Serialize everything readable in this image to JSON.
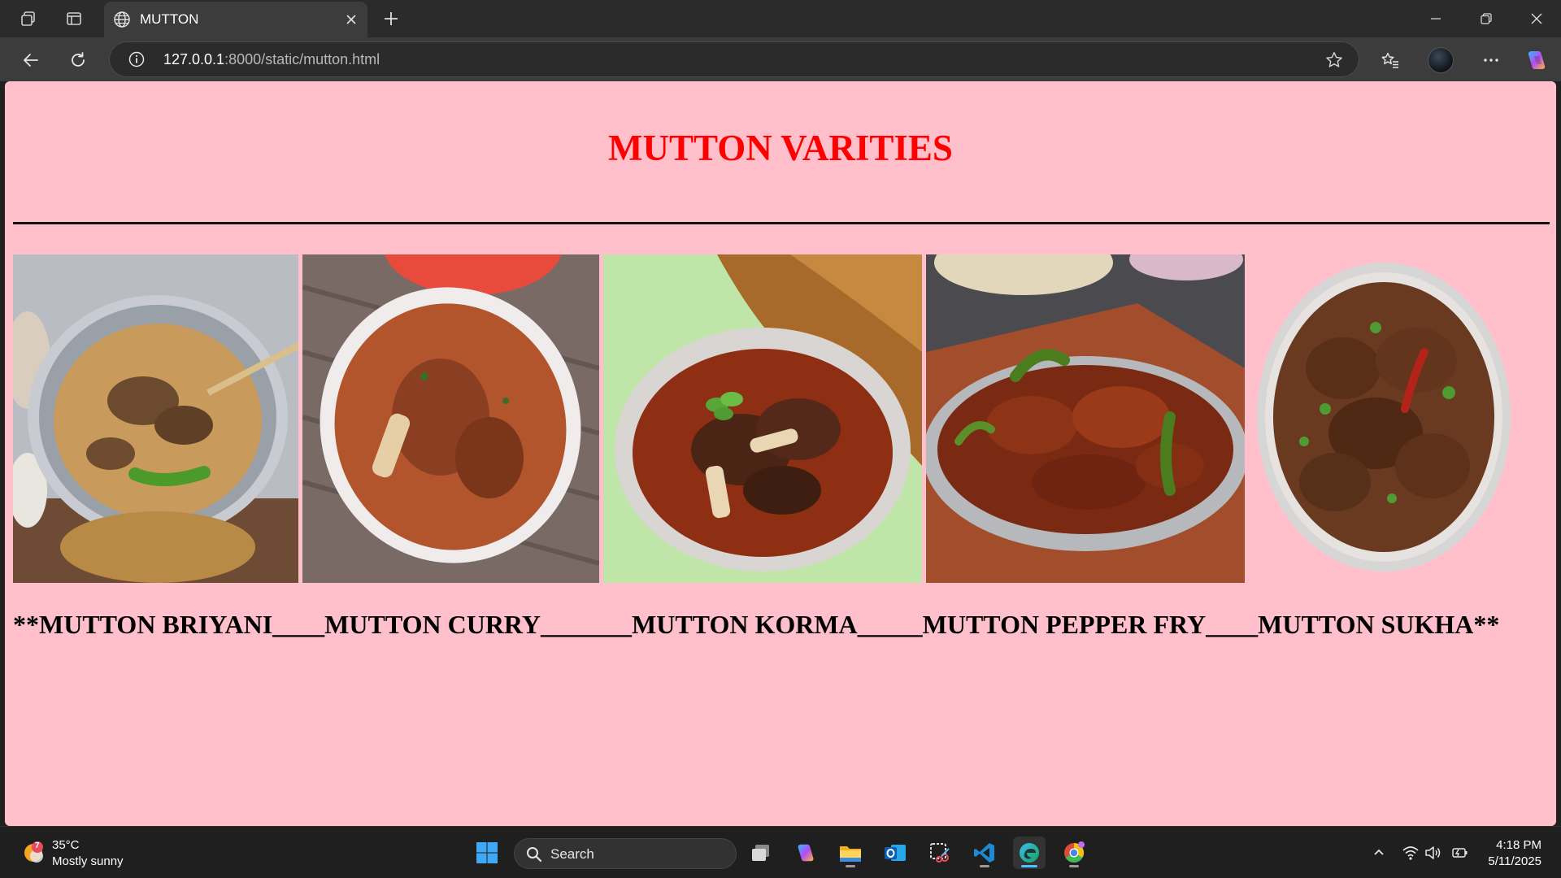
{
  "browser": {
    "tab_title": "MUTTON",
    "url_host": "127.0.0.1",
    "url_path": ":8000/static/mutton.html"
  },
  "page": {
    "heading": "MUTTON VARITIES",
    "dishes": [
      {
        "name": "MUTTON BRIYANI",
        "image": "mutton-briyani-photo"
      },
      {
        "name": "MUTTON CURRY",
        "image": "mutton-curry-photo"
      },
      {
        "name": "MUTTON KORMA",
        "image": "mutton-korma-photo"
      },
      {
        "name": "MUTTON PEPPER FRY",
        "image": "mutton-pepper-fry-photo"
      },
      {
        "name": "MUTTON SUKHA",
        "image": "mutton-sukha-photo"
      }
    ],
    "caption": "**MUTTON BRIYANI____MUTTON CURRY_______MUTTON KORMA_____MUTTON PEPPER FRY____MUTTON SUKHA**",
    "colors": {
      "background": "#ffc0cb",
      "heading": "#ff0000",
      "text": "#000000"
    }
  },
  "taskbar": {
    "weather_temp": "35°C",
    "weather_desc": "Mostly sunny",
    "weather_badge": "7",
    "search_label": "Search",
    "time": "4:18 PM",
    "date": "5/11/2025"
  }
}
